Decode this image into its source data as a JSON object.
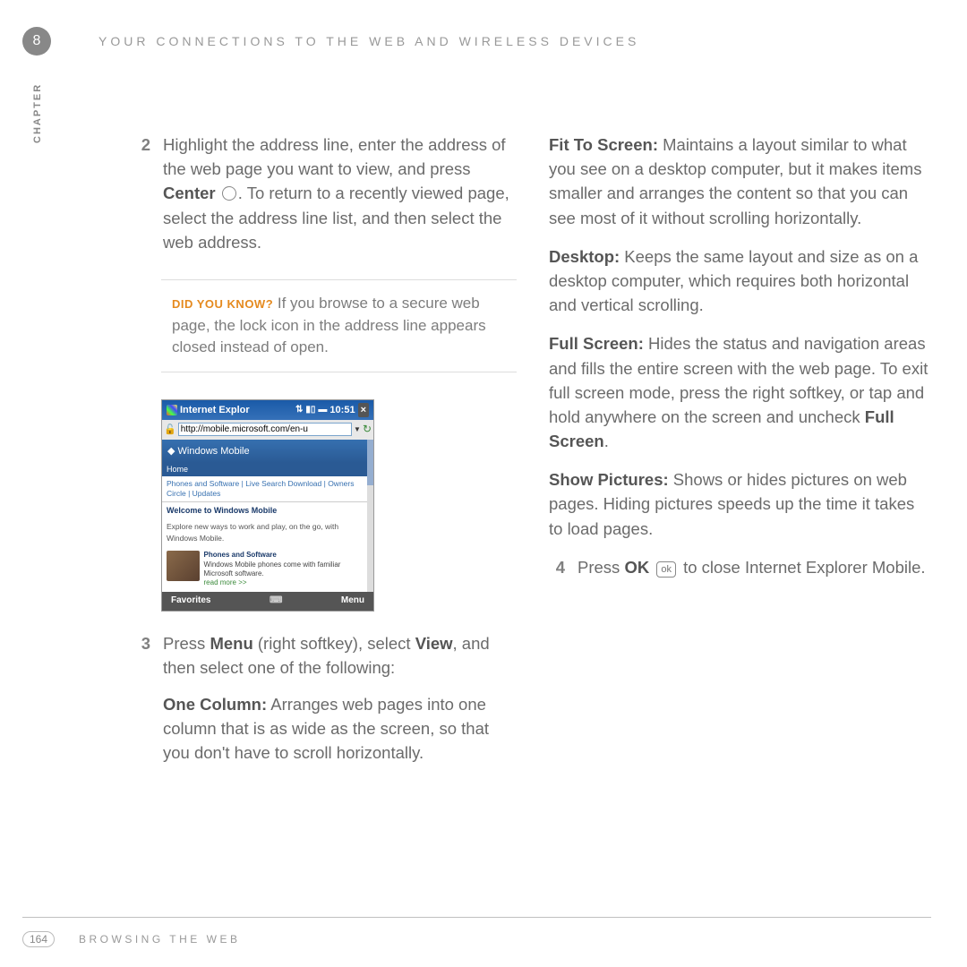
{
  "header": {
    "chapter_number": "8",
    "chapter_title": "YOUR CONNECTIONS TO THE WEB AND WIRELESS DEVICES",
    "chapter_label": "CHAPTER"
  },
  "left": {
    "step2_num": "2",
    "step2_a": "Highlight the address line, enter the address of the web page you want to view, and press ",
    "step2_center": "Center",
    "step2_b": ". To return to a recently viewed page, select the address line list, and then select the web address.",
    "callout_label": "DID YOU KNOW?",
    "callout_text": " If you browse to a secure web page, the lock icon in the address line appears closed instead of open.",
    "step3_num": "3",
    "step3_a": "Press ",
    "step3_menu": "Menu",
    "step3_b": " (right softkey), select ",
    "step3_view": "View",
    "step3_c": ", and then select one of the following:",
    "onecol_label": "One Column:",
    "onecol_text": " Arranges web pages into one column that is as wide as the screen, so that you don't have to scroll horizontally."
  },
  "right": {
    "fit_label": "Fit To Screen:",
    "fit_text": " Maintains a layout similar to what you see on a desktop computer, but it makes items smaller and arranges the content so that you can see most of it without scrolling horizontally.",
    "desktop_label": "Desktop:",
    "desktop_text": " Keeps the same layout and size as on a desktop computer, which requires both horizontal and vertical scrolling.",
    "full_label": "Full Screen:",
    "full_text_a": " Hides the status and navigation areas and fills the entire screen with the web page. To exit full screen mode, press the right softkey, or tap and hold anywhere on the screen and uncheck ",
    "full_text_b": "Full Screen",
    "full_text_c": ".",
    "show_label": "Show Pictures:",
    "show_text": " Shows or hides pictures on web pages. Hiding pictures speeds up the time it takes to load pages.",
    "step4_num": "4",
    "step4_a": "Press ",
    "step4_ok": "OK",
    "step4_icon": "ok",
    "step4_b": " to close Internet Explorer Mobile."
  },
  "screenshot": {
    "title": "Internet Explor",
    "time": "10:51",
    "url": "http://mobile.microsoft.com/en-u",
    "banner": "Windows Mobile",
    "home": "Home",
    "links": "Phones and Software | Live Search Download | Owners Circle | Updates",
    "welcome": "Welcome to Windows Mobile",
    "desc": "Explore new ways to work and play, on the go, with Windows Mobile.",
    "feature_title": "Phones and Software",
    "feature_desc": "Windows Mobile phones come with familiar Microsoft software.",
    "readmore": "read more >>",
    "left_soft": "Favorites",
    "right_soft": "Menu"
  },
  "footer": {
    "page": "164",
    "section": "BROWSING THE WEB"
  }
}
